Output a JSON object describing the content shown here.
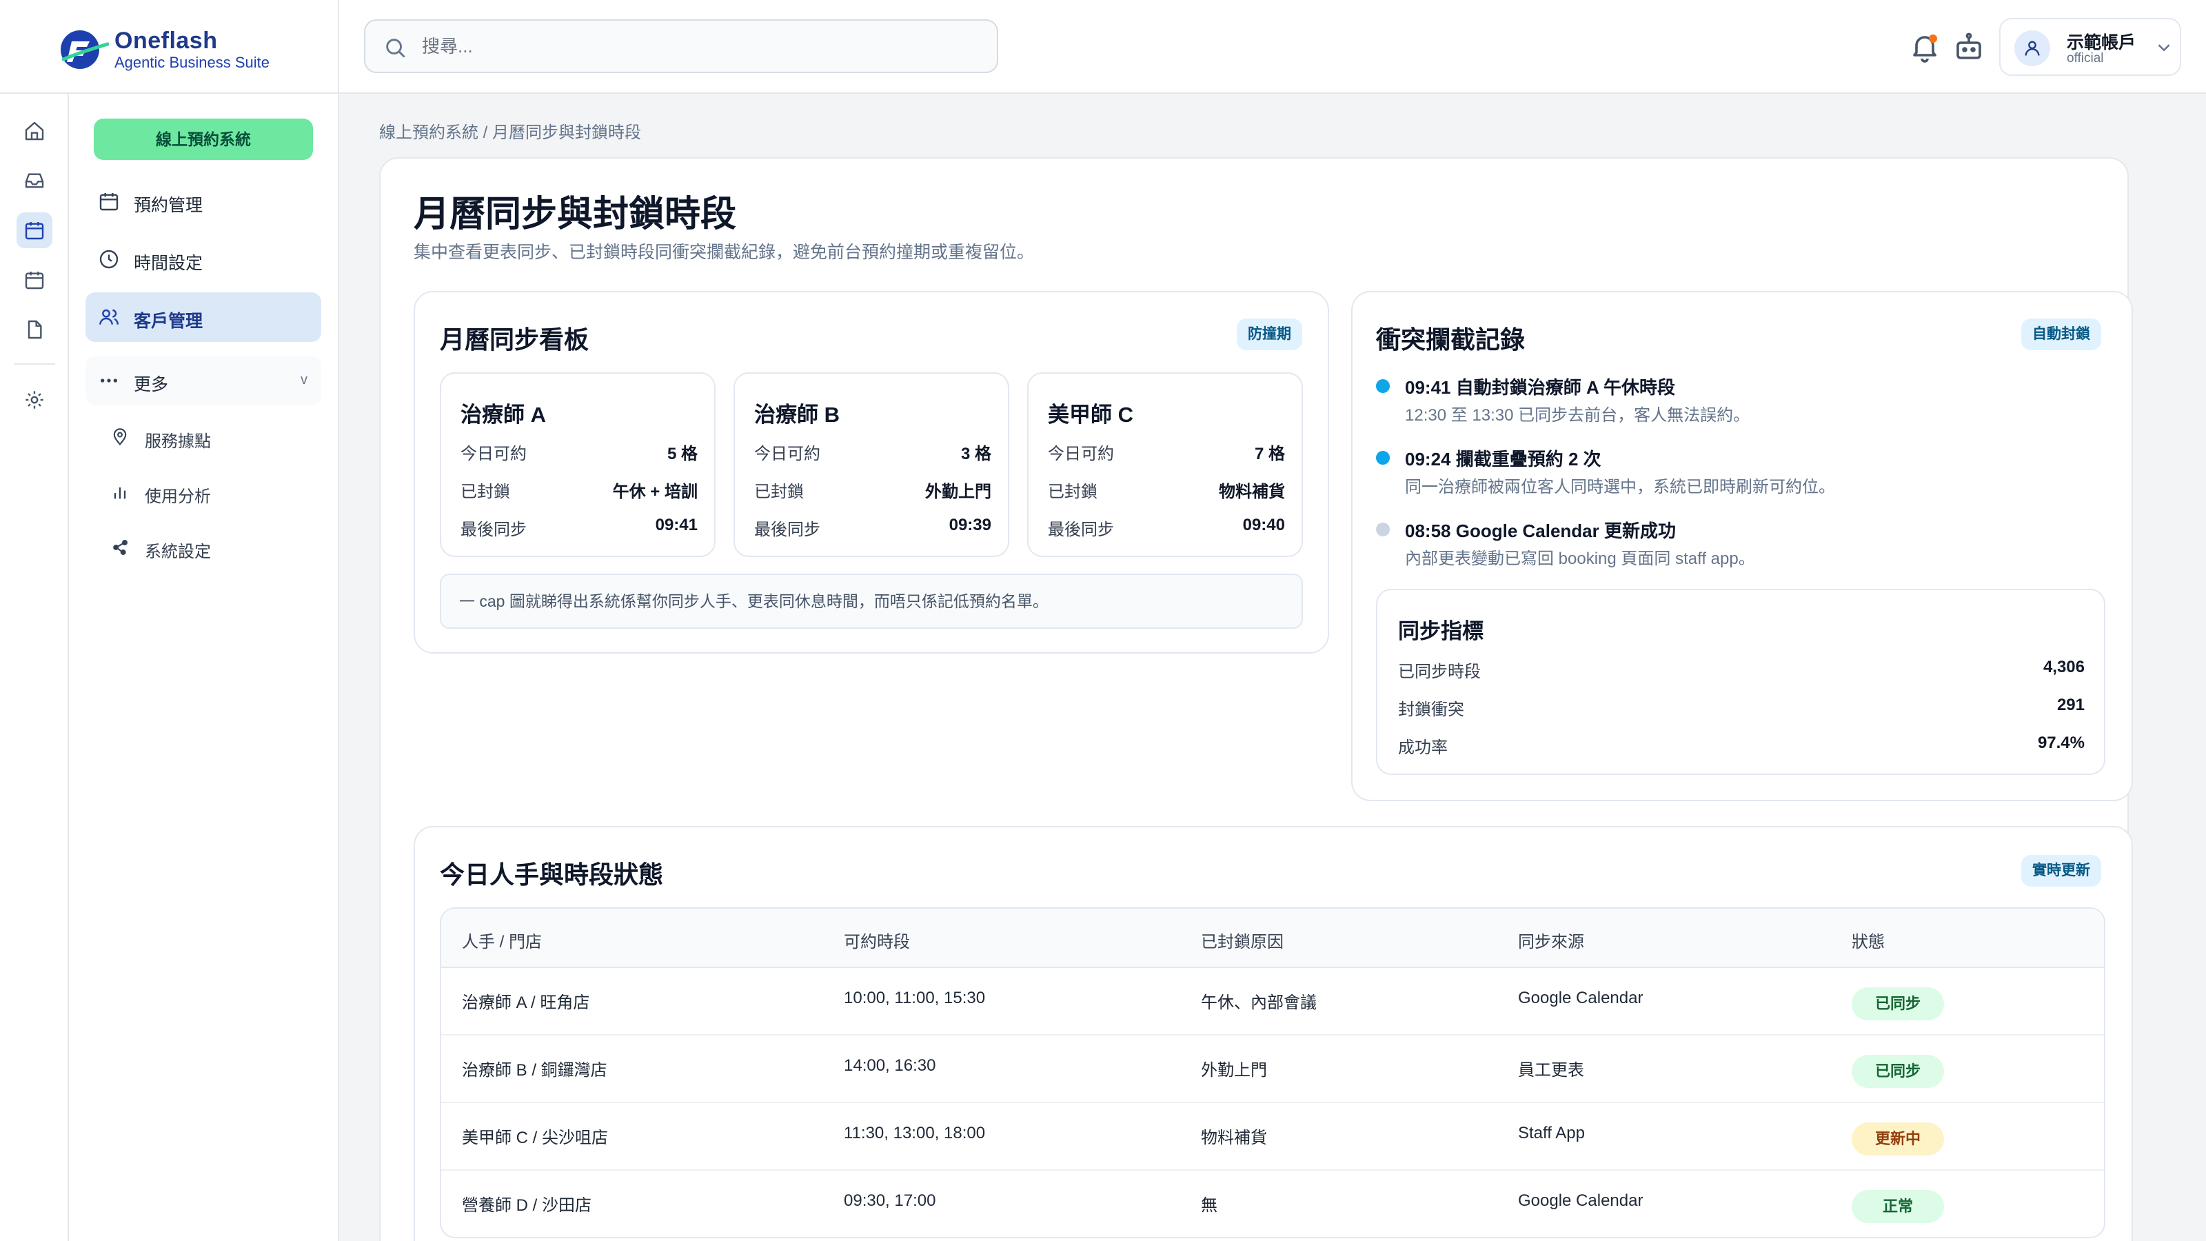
{
  "brand": {
    "name": "Oneflash",
    "tagline": "Agentic Business Suite"
  },
  "search": {
    "placeholder": "搜尋..."
  },
  "account": {
    "name": "示範帳戶",
    "sub": "official"
  },
  "sidebar": {
    "system_button": "線上預約系統",
    "items": [
      {
        "label": "預約管理",
        "icon": "calendar-icon"
      },
      {
        "label": "時間設定",
        "icon": "clock-icon"
      },
      {
        "label": "客戶管理",
        "icon": "users-icon",
        "active": true
      },
      {
        "label": "更多",
        "icon": "more-icon",
        "chevron": "v"
      }
    ],
    "sub_items": [
      {
        "label": "服務據點",
        "icon": "map-pin-icon"
      },
      {
        "label": "使用分析",
        "icon": "bar-chart-icon"
      },
      {
        "label": "系統設定",
        "icon": "share-icon"
      }
    ]
  },
  "breadcrumb": "線上預約系統 / 月曆同步與封鎖時段",
  "page": {
    "title": "月曆同步與封鎖時段",
    "description": "集中查看更表同步、已封鎖時段同衝突攔截紀錄，避免前台預約撞期或重複留位。"
  },
  "calendar_board": {
    "title": "月曆同步看板",
    "tag": "防撞期",
    "row_labels": {
      "available": "今日可約",
      "blocked": "已封鎖",
      "last_sync": "最後同步"
    },
    "staff": [
      {
        "name": "治療師 A",
        "available": "5 格",
        "blocked": "午休 + 培訓",
        "last_sync": "09:41"
      },
      {
        "name": "治療師 B",
        "available": "3 格",
        "blocked": "外勤上門",
        "last_sync": "09:39"
      },
      {
        "name": "美甲師 C",
        "available": "7 格",
        "blocked": "物料補貨",
        "last_sync": "09:40"
      }
    ],
    "note": "一 cap 圖就睇得出系統係幫你同步人手、更表同休息時間，而唔只係記低預約名單。"
  },
  "conflict_log": {
    "title": "衝突攔截記錄",
    "tag": "自動封鎖",
    "events": [
      {
        "title": "09:41 自動封鎖治療師 A 午休時段",
        "desc": "12:30 至 13:30 已同步去前台，客人無法誤約。",
        "color": "#0ea5e9"
      },
      {
        "title": "09:24 攔截重疊預約 2 次",
        "desc": "同一治療師被兩位客人同時選中，系統已即時刷新可約位。",
        "color": "#0ea5e9"
      },
      {
        "title": "08:58 Google Calendar 更新成功",
        "desc": "內部更表變動已寫回 booking 頁面同 staff app。",
        "color": "#cbd5e1"
      }
    ],
    "metrics": {
      "title": "同步指標",
      "rows": [
        {
          "label": "已同步時段",
          "value": "4,306"
        },
        {
          "label": "封鎖衝突",
          "value": "291"
        },
        {
          "label": "成功率",
          "value": "97.4%"
        }
      ]
    }
  },
  "staff_table": {
    "title": "今日人手與時段狀態",
    "tag": "實時更新",
    "columns": [
      "人手 / 門店",
      "可約時段",
      "已封鎖原因",
      "同步來源",
      "狀態"
    ],
    "rows": [
      {
        "staff": "治療師 A / 旺角店",
        "slots": "10:00, 11:00, 15:30",
        "reason": "午休、內部會議",
        "source": "Google Calendar",
        "status": "已同步",
        "status_kind": "ok"
      },
      {
        "staff": "治療師 B / 銅鑼灣店",
        "slots": "14:00, 16:30",
        "reason": "外勤上門",
        "source": "員工更表",
        "status": "已同步",
        "status_kind": "ok"
      },
      {
        "staff": "美甲師 C / 尖沙咀店",
        "slots": "11:30, 13:00, 18:00",
        "reason": "物料補貨",
        "source": "Staff App",
        "status": "更新中",
        "status_kind": "warn"
      },
      {
        "staff": "營養師 D / 沙田店",
        "slots": "09:30, 17:00",
        "reason": "無",
        "source": "Google Calendar",
        "status": "正常",
        "status_kind": "ok"
      }
    ]
  },
  "colors": {
    "accent": "#1e3a8a",
    "active_bg": "#dbe8f8",
    "system_button": "#6ee7a0",
    "tag_bg": "#e0f2fe",
    "dot_active": "#0ea5e9",
    "dot_muted": "#cbd5e1"
  }
}
